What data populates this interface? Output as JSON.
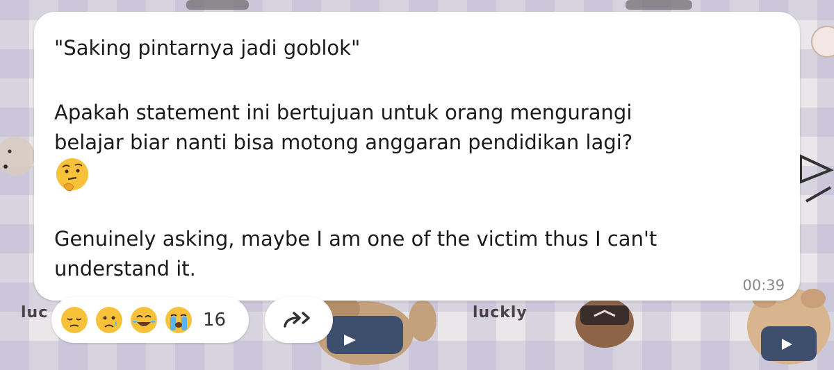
{
  "wallpaper": {
    "label_left": "luc",
    "label_center": "luckly"
  },
  "message": {
    "line1": "\"Saking pintarnya jadi goblok\"",
    "line2": "Apakah statement ini bertujuan untuk orang mengurangi",
    "line3": "belajar biar nanti bisa motong anggaran pendidikan lagi?",
    "emoji": "thinking-face-emoji",
    "line4": "Genuinely asking, maybe I am one of the victim thus I can't",
    "line5": "understand it.",
    "time": "00:39"
  },
  "reactions": {
    "emojis": [
      "pensive-face",
      "sad-relieved-face",
      "tears-of-joy-face",
      "loudly-crying-face"
    ],
    "count": "16"
  },
  "forward": {
    "icon": "forward-double-arrow-icon"
  },
  "colors": {
    "bubble": "#ffffff",
    "text": "#1b1b1b",
    "time": "#8a8a8a",
    "emoji_yellow": "#f7c23a"
  }
}
